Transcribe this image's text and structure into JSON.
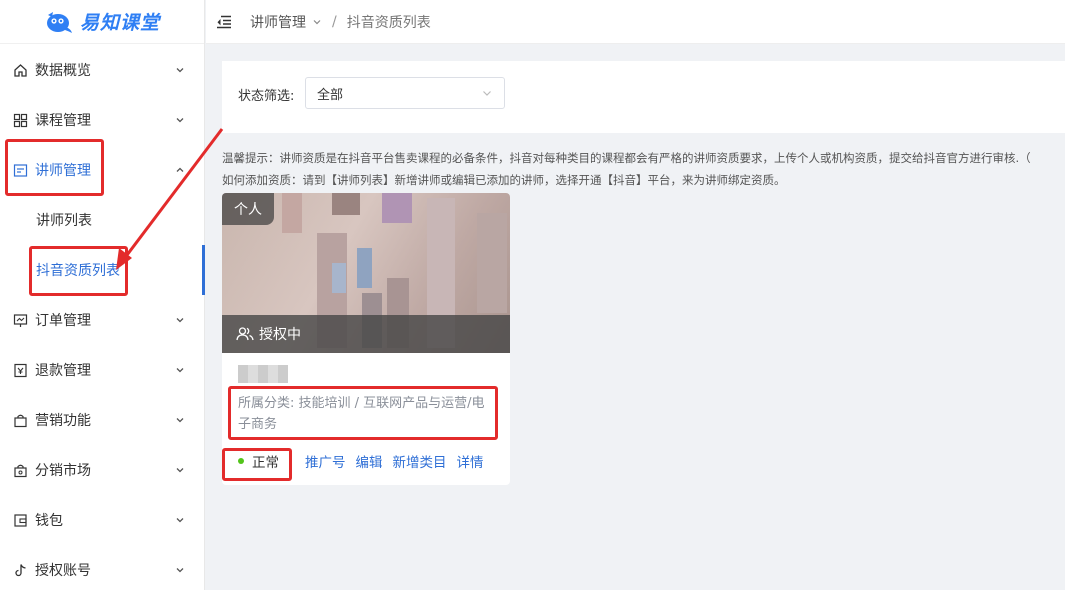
{
  "app": {
    "logo_text": "易知课堂"
  },
  "header": {
    "crumb_parent": "讲师管理",
    "crumb_sep": "/",
    "crumb_current": "抖音资质列表"
  },
  "sidebar": {
    "items": [
      {
        "label": "数据概览",
        "icon": "home-icon"
      },
      {
        "label": "课程管理",
        "icon": "grid-icon"
      },
      {
        "label": "讲师管理",
        "icon": "teacher-icon",
        "open": true
      },
      {
        "label": "订单管理",
        "icon": "order-icon"
      },
      {
        "label": "退款管理",
        "icon": "refund-icon"
      },
      {
        "label": "营销功能",
        "icon": "bag-icon"
      },
      {
        "label": "分销市场",
        "icon": "market-icon"
      },
      {
        "label": "钱包",
        "icon": "wallet-icon"
      },
      {
        "label": "授权账号",
        "icon": "tiktok-icon"
      }
    ],
    "sub_items": [
      {
        "label": "讲师列表"
      },
      {
        "label": "抖音资质列表",
        "active": true
      }
    ]
  },
  "filter": {
    "label": "状态筛选:",
    "value": "全部"
  },
  "tips": {
    "line1": "温馨提示：讲师资质是在抖音平台售卖课程的必备条件，抖音对每种类目的课程都会有严格的讲师资质要求，上传个人或机构资质，提交给抖音官方进行审核.（",
    "line2": "如何添加资质：请到【讲师列表】新增讲师或编辑已添加的讲师，选择开通【抖音】平台，来为讲师绑定资质。"
  },
  "card": {
    "tag": "个人",
    "auth_status": "授权中",
    "category_label": "所属分类:",
    "category_value": "技能培训 / 互联网产品与运营/电子商务",
    "status": "正常",
    "links": [
      "推广号",
      "编辑",
      "新增类目",
      "详情"
    ]
  },
  "colors": {
    "accent": "#2f6fd6",
    "annotation_red": "#e32b2b",
    "status_green": "#52c41a"
  }
}
